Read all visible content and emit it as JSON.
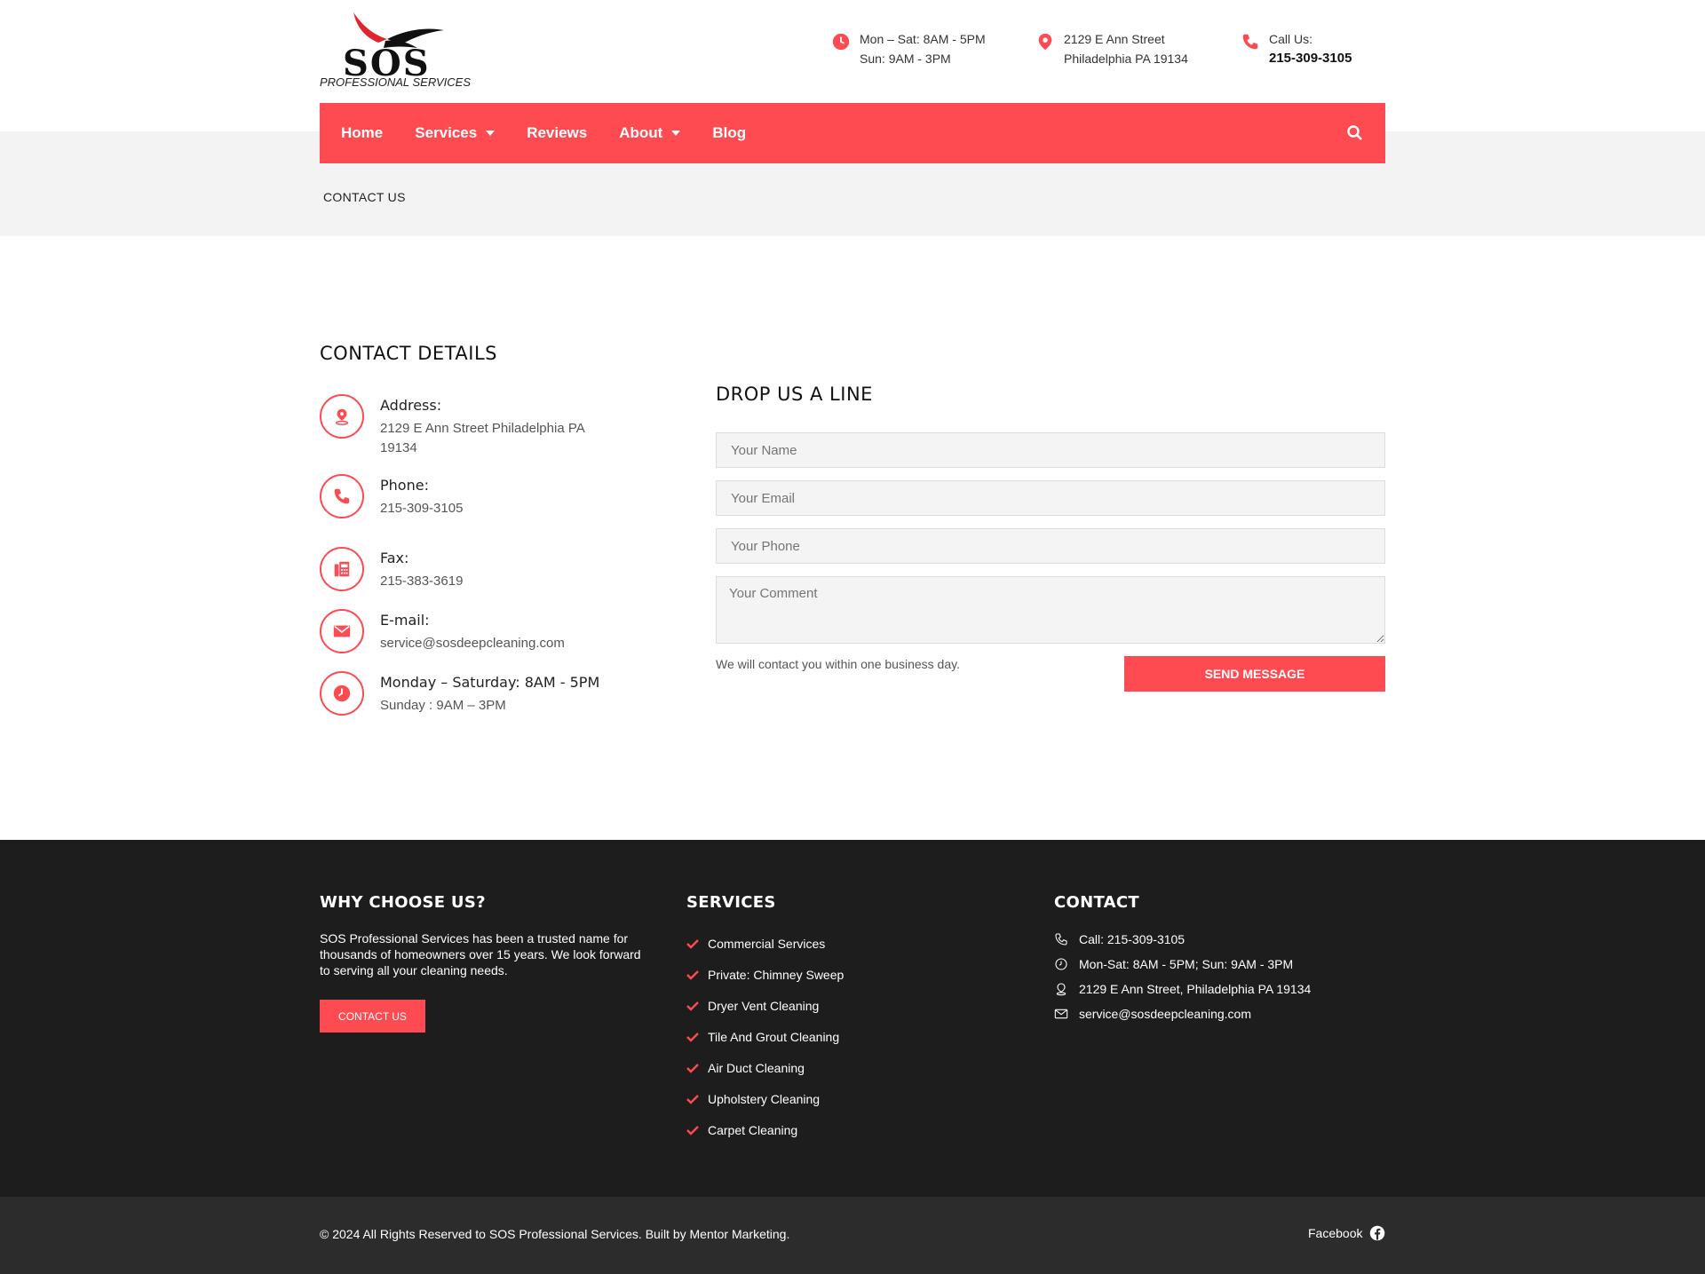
{
  "brand": {
    "logo_name": "SOS",
    "logo_sub": "PROFESSIONAL SERVICES",
    "accent": "#fe4a51",
    "footer_bg": "#1d1d1d"
  },
  "topbar": {
    "hours_line1": "Mon – Sat: 8AM - 5PM",
    "hours_line2": "Sun: 9AM - 3PM",
    "address_line1": "2129 E Ann Street",
    "address_line2": "Philadelphia PA 19134",
    "call_label": "Call Us:",
    "call_number": "215-309-3105"
  },
  "nav": {
    "items": [
      {
        "label": "Home"
      },
      {
        "label": "Services"
      },
      {
        "label": "Reviews"
      },
      {
        "label": "About"
      },
      {
        "label": "Blog"
      }
    ]
  },
  "breadcrumb": "CONTACT US",
  "details": {
    "title": "CONTACT DETAILS",
    "address_label": "Address:",
    "address_value": "2129 E Ann Street Philadelphia PA 19134",
    "phone_label": "Phone:",
    "phone_value": "215-309-3105",
    "fax_label": "Fax:",
    "fax_value": "215-383-3619",
    "email_label": "E-mail:",
    "email_value": "service@sosdeepcleaning.com",
    "hours_label": "Monday – Saturday: 8AM - 5PM",
    "hours_value": "Sunday : 9AM – 3PM"
  },
  "form": {
    "title": "DROP US A LINE",
    "name_placeholder": "Your Name",
    "email_placeholder": "Your Email",
    "phone_placeholder": "Your Phone",
    "comment_placeholder": "Your Comment",
    "note": "We will contact you within one business day.",
    "submit": "SEND MESSAGE"
  },
  "footer": {
    "why_title": "WHY CHOOSE US?",
    "why_text": "SOS Professional Services has been a trusted name for thousands of homeowners over 15 years. We look forward to serving all your cleaning needs.",
    "contact_button": "CONTACT US",
    "services_title": "SERVICES",
    "services": [
      "Commercial Services",
      "Private: Chimney Sweep",
      "Dryer Vent Cleaning",
      "Tile And Grout Cleaning",
      "Air Duct Cleaning",
      "Upholstery Cleaning",
      "Carpet Cleaning"
    ],
    "contact_title": "CONTACT",
    "contact_call": "Call: 215-309-3105",
    "contact_hours": "Mon-Sat: 8AM - 5PM; Sun: 9AM - 3PM",
    "contact_address": "2129 E Ann Street, Philadelphia PA 19134",
    "contact_email": "service@sosdeepcleaning.com",
    "copyright": "© 2024 All Rights Reserved to SOS Professional Services. Built by Mentor Marketing.",
    "facebook": "Facebook"
  }
}
